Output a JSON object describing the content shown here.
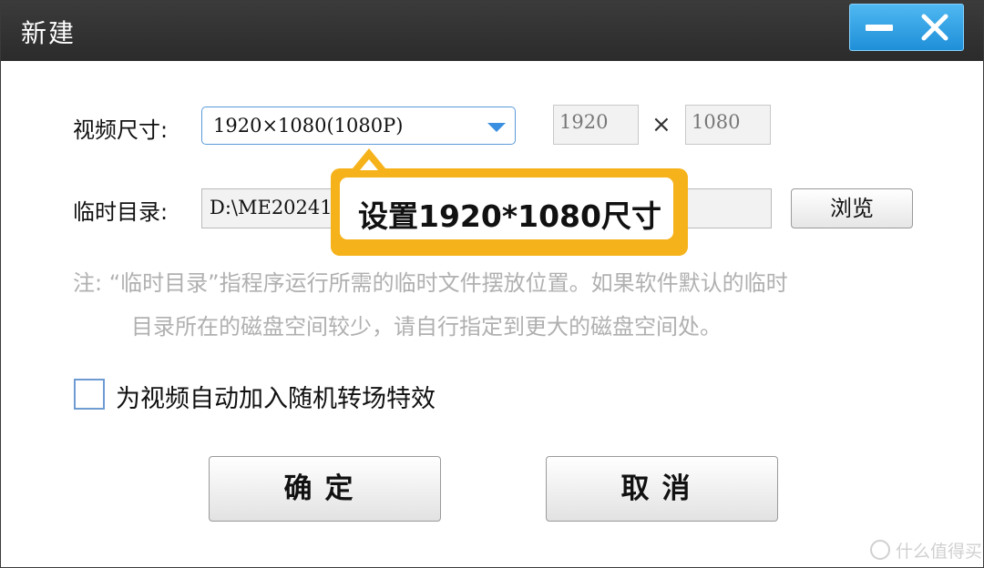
{
  "window": {
    "title": "新建",
    "minimize_icon": "minimize-icon",
    "close_icon": "close-icon",
    "accent": "#1f8fd8"
  },
  "video_size": {
    "label": "视频尺寸:",
    "selected": "1920×1080(1080P)",
    "width": "1920",
    "times": "×",
    "height": "1080"
  },
  "temp_dir": {
    "label": "临时目录:",
    "value": "D:\\ME20241",
    "browse_label": "浏览"
  },
  "note": {
    "line1": "注:  “临时目录”指程序运行所需的临时文件摆放位置。如果软件默认的临时",
    "line2": "目录所在的磁盘空间较少，请自行指定到更大的磁盘空间处。"
  },
  "transition": {
    "label": "为视频自动加入随机转场特效",
    "checked": false
  },
  "buttons": {
    "ok": "确定",
    "cancel": "取消"
  },
  "callout": {
    "text": "设置1920*1080尺寸",
    "color": "#f6b21b"
  },
  "watermark": {
    "text": "什么值得买"
  }
}
